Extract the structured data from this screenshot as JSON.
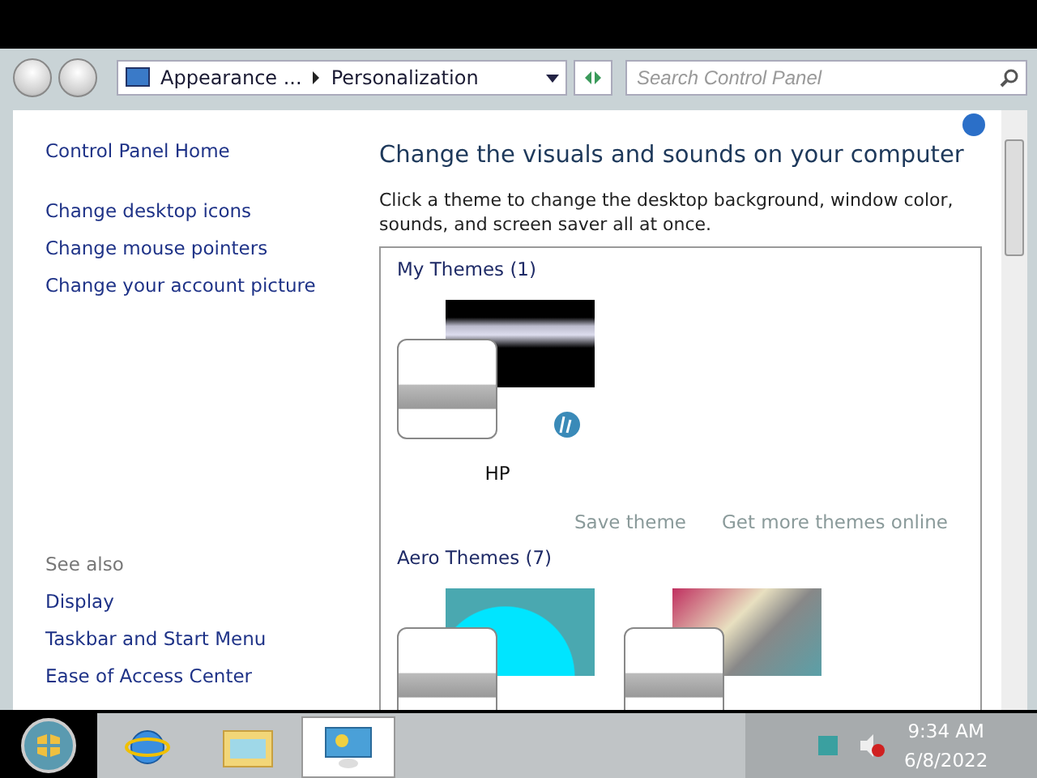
{
  "address_bar": {
    "crumbs": [
      "Appearance ...",
      "Personalization"
    ],
    "search": {
      "placeholder": "Search Control Panel"
    }
  },
  "sidebar": {
    "items": [
      "Control Panel Home",
      "Change desktop icons",
      "Change mouse pointers",
      "Change your account picture"
    ],
    "see_also": {
      "heading": "See also",
      "items": [
        "Display",
        "Taskbar and Start Menu",
        "Ease of Access Center"
      ]
    }
  },
  "main": {
    "title": "Change the visuals and sounds on your computer",
    "description": "Click a theme to change the desktop background, window color, sounds, and screen saver all at once.",
    "groups": [
      {
        "heading": "My Themes (1)",
        "themes": [
          {
            "kind": "dark",
            "name": "HP",
            "logo": true
          }
        ],
        "links": [
          "Save theme",
          "Get more themes online"
        ]
      },
      {
        "heading": "Aero Themes (7)",
        "themes": [
          {
            "kind": "bright"
          },
          {
            "kind": "stack"
          }
        ]
      }
    ]
  },
  "taskbar": {
    "apps": [
      {
        "kind": "browser",
        "selected": false
      },
      {
        "kind": "library",
        "selected": false
      },
      {
        "kind": "control-panel",
        "selected": true
      }
    ],
    "clock": {
      "time": "9:34 AM",
      "date": "6/8/2022"
    }
  }
}
